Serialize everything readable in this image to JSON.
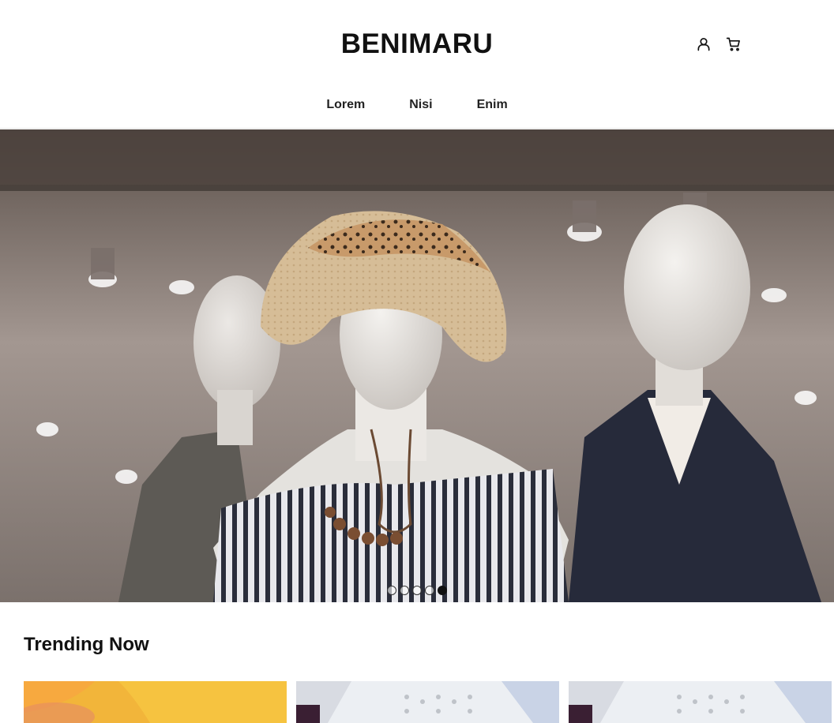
{
  "brand": {
    "name": "BENIMARU"
  },
  "header_icons": [
    "account-icon",
    "cart-icon"
  ],
  "nav": {
    "items": [
      {
        "label": "Lorem"
      },
      {
        "label": "Nisi"
      },
      {
        "label": "Enim"
      }
    ]
  },
  "hero": {
    "slide_count": 5,
    "active_slide": 5
  },
  "trending": {
    "title": "Trending Now",
    "cards": 3
  }
}
